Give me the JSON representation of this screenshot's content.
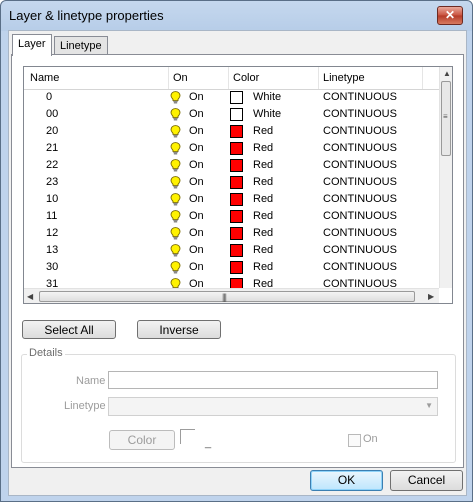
{
  "window": {
    "title": "Layer & linetype properties",
    "close_glyph": "✕"
  },
  "tabs": [
    {
      "label": "Layer"
    },
    {
      "label": "Linetype"
    }
  ],
  "columns": {
    "name": "Name",
    "on": "On",
    "color": "Color",
    "linetype": "Linetype"
  },
  "layers": [
    {
      "name": "0",
      "on": "On",
      "color": "White",
      "swatch": "#ffffff",
      "linetype": "CONTINUOUS"
    },
    {
      "name": "00",
      "on": "On",
      "color": "White",
      "swatch": "#ffffff",
      "linetype": "CONTINUOUS"
    },
    {
      "name": "20",
      "on": "On",
      "color": "Red",
      "swatch": "#ff0000",
      "linetype": "CONTINUOUS"
    },
    {
      "name": "21",
      "on": "On",
      "color": "Red",
      "swatch": "#ff0000",
      "linetype": "CONTINUOUS"
    },
    {
      "name": "22",
      "on": "On",
      "color": "Red",
      "swatch": "#ff0000",
      "linetype": "CONTINUOUS"
    },
    {
      "name": "23",
      "on": "On",
      "color": "Red",
      "swatch": "#ff0000",
      "linetype": "CONTINUOUS"
    },
    {
      "name": "10",
      "on": "On",
      "color": "Red",
      "swatch": "#ff0000",
      "linetype": "CONTINUOUS"
    },
    {
      "name": "11",
      "on": "On",
      "color": "Red",
      "swatch": "#ff0000",
      "linetype": "CONTINUOUS"
    },
    {
      "name": "12",
      "on": "On",
      "color": "Red",
      "swatch": "#ff0000",
      "linetype": "CONTINUOUS"
    },
    {
      "name": "13",
      "on": "On",
      "color": "Red",
      "swatch": "#ff0000",
      "linetype": "CONTINUOUS"
    },
    {
      "name": "30",
      "on": "On",
      "color": "Red",
      "swatch": "#ff0000",
      "linetype": "CONTINUOUS"
    },
    {
      "name": "31",
      "on": "On",
      "color": "Red",
      "swatch": "#ff0000",
      "linetype": "CONTINUOUS"
    },
    {
      "name": "",
      "on": "",
      "color": "",
      "swatch": "#ff0000",
      "linetype": ""
    }
  ],
  "buttons": {
    "select_all": "Select All",
    "inverse": "Inverse",
    "ok": "OK",
    "cancel": "Cancel"
  },
  "details": {
    "legend": "Details",
    "name_label": "Name",
    "name_value": "",
    "linetype_label": "Linetype",
    "linetype_value": "",
    "color_button": "Color",
    "color_value": "_",
    "on_label": "On"
  },
  "icons": {
    "bulb": "lightbulb-on-icon",
    "scroll_grip": "grip-icon"
  }
}
